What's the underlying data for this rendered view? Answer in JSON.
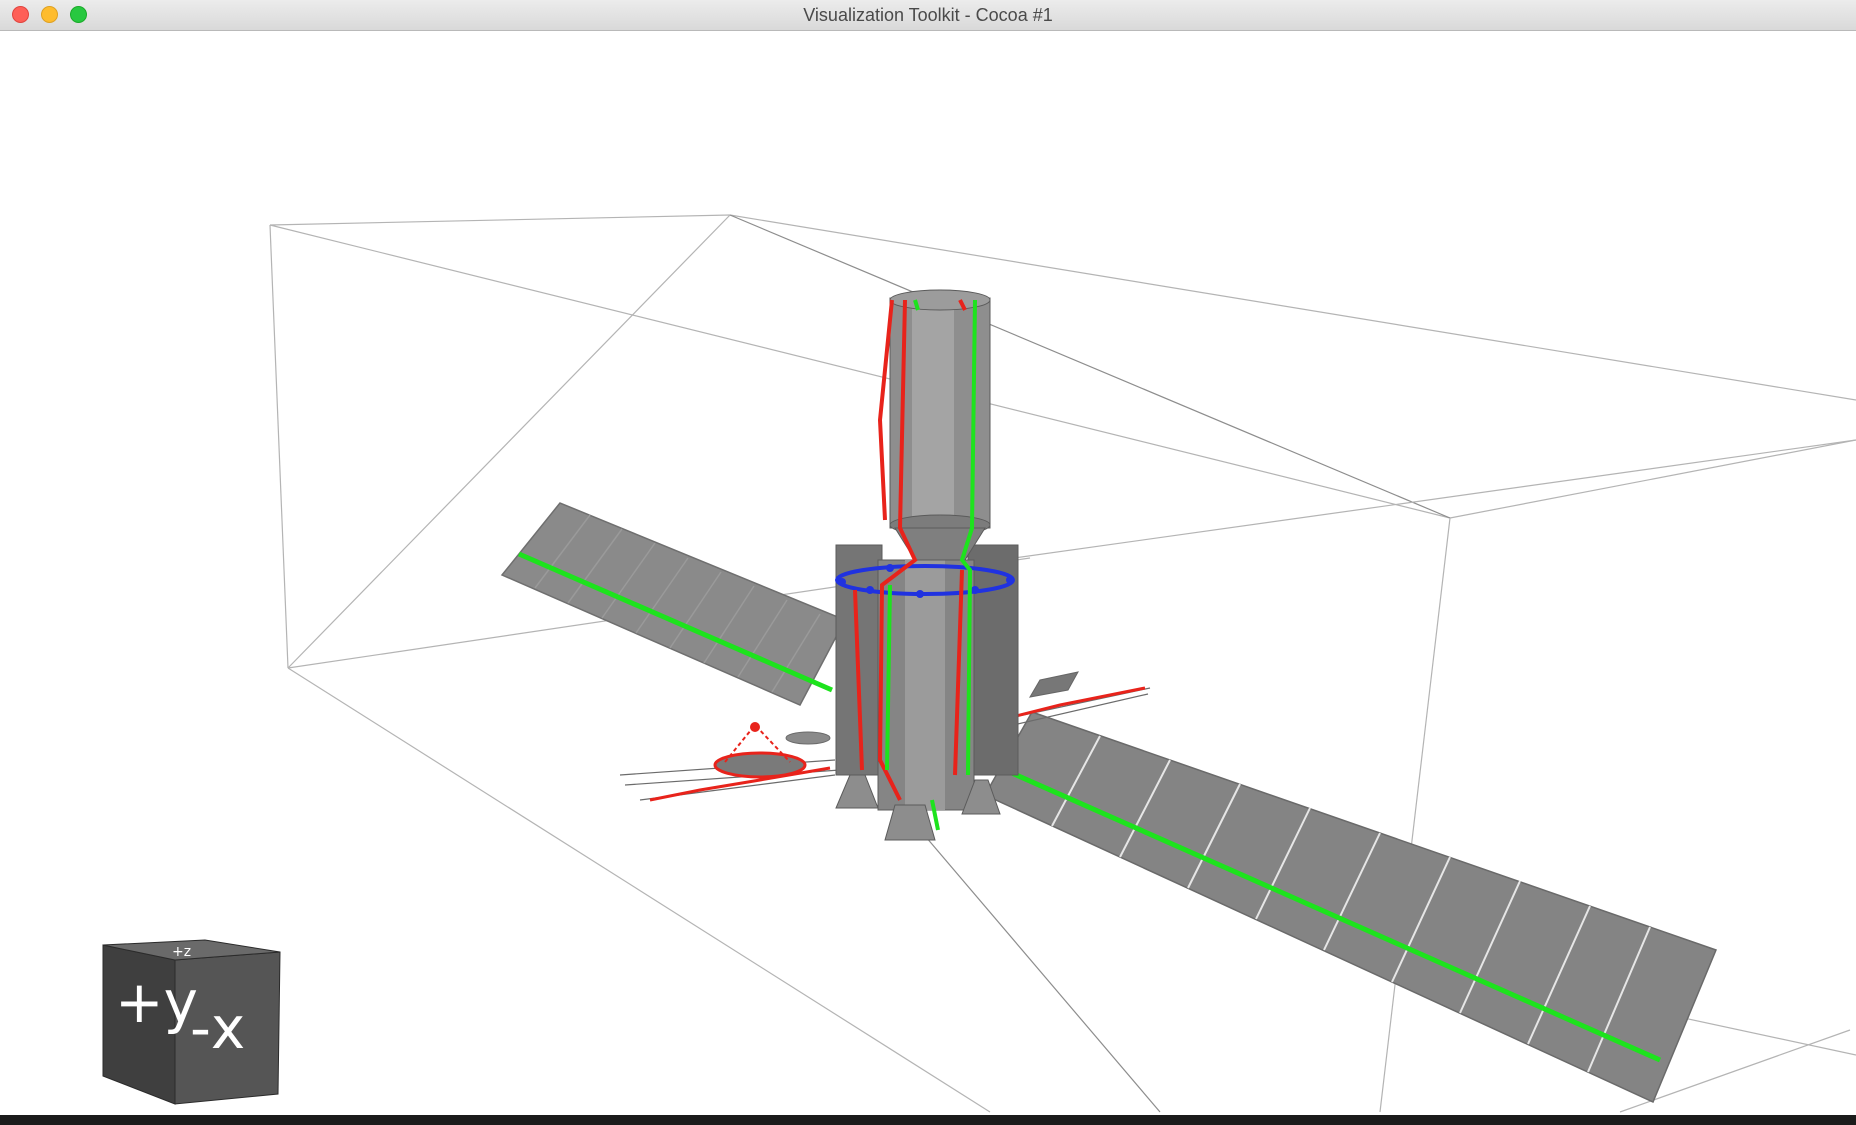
{
  "window": {
    "title": "Visualization Toolkit - Cocoa #1",
    "controls": {
      "close": "close-icon",
      "minimize": "minimize-icon",
      "zoom": "zoom-icon"
    }
  },
  "viewport": {
    "background": "#ffffff",
    "model": "satellite-model",
    "colors": {
      "body": "#7a7a7a",
      "panel": "#8a8a8a",
      "outline": "#b4b4b4",
      "red_edges": "#e8231b",
      "green_edges": "#1de31d",
      "blue_edges": "#2032e0"
    }
  },
  "orientation_cube": {
    "front_label": "+y",
    "side_label": "-x",
    "top_label": "+z"
  }
}
